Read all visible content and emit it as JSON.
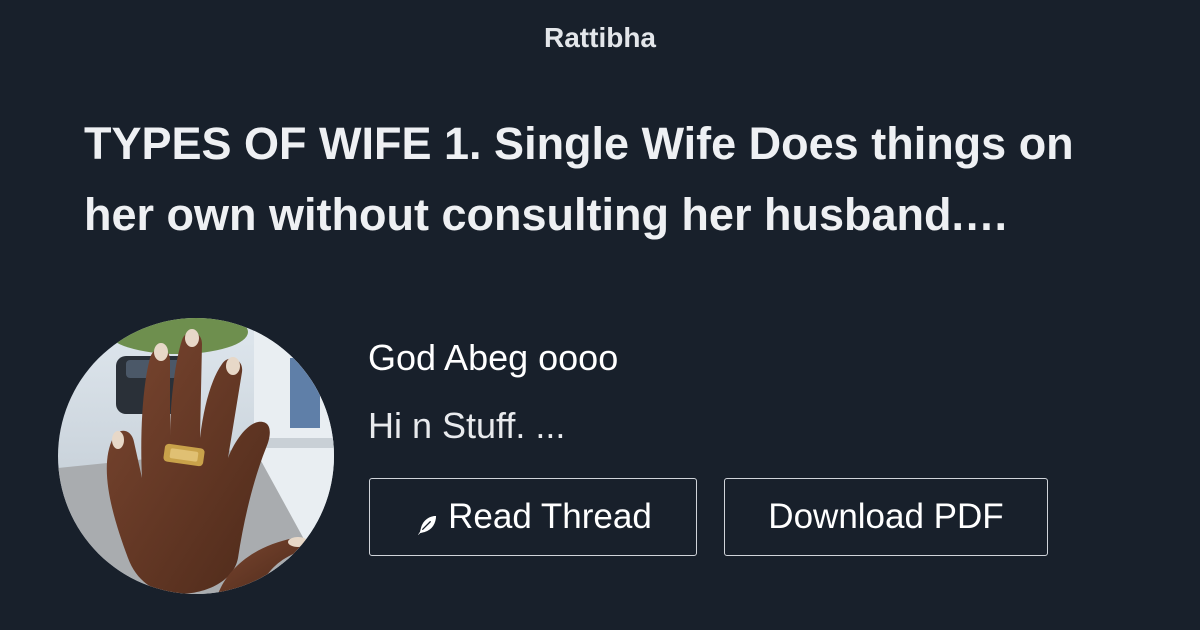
{
  "brand": "Rattibha",
  "thread": {
    "title": "TYPES OF WIFE 1. Single Wife Does things on her own without consulting her husband.…"
  },
  "author": {
    "name": "God Abeg oooo",
    "bio": "Hi n Stuff. ..."
  },
  "actions": {
    "read_label": "Read Thread",
    "pdf_label": "Download PDF"
  },
  "icons": {
    "read": "feather-icon"
  },
  "colors": {
    "background": "#18202b",
    "text": "#ffffff",
    "button_border": "#d0d4da"
  }
}
